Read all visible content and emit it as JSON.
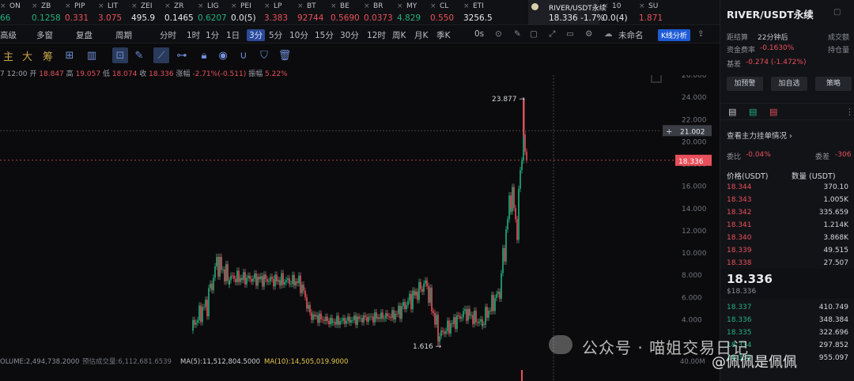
{
  "ticker": [
    {
      "name": "ON",
      "price": "66",
      "color": "#22b07d"
    },
    {
      "name": "ZB",
      "price": "0.1258",
      "color": "#22b07d"
    },
    {
      "name": "PIP",
      "price": "0.331",
      "color": "#e8505b"
    },
    {
      "name": "LIT",
      "price": "3.075",
      "color": "#e8505b"
    },
    {
      "name": "ZEI",
      "price": "495.9",
      "color": "#e7e9ec"
    },
    {
      "name": "ZR",
      "price": "0.1465",
      "color": "#e7e9ec"
    },
    {
      "name": "LIG",
      "price": "0.6207",
      "color": "#22b07d"
    },
    {
      "name": "PEI",
      "price": "0.0(5)",
      "color": "#e7e9ec"
    },
    {
      "name": "LP",
      "price": "3.383",
      "color": "#e8505b"
    },
    {
      "name": "BT",
      "price": "92744",
      "color": "#e8505b"
    },
    {
      "name": "BE",
      "price": "0.5690",
      "color": "#e8505b"
    },
    {
      "name": "BR",
      "price": "0.0373",
      "color": "#e8505b"
    },
    {
      "name": "MY",
      "price": "4.829",
      "color": "#22b07d"
    },
    {
      "name": "CL",
      "price": "0.550",
      "color": "#e8505b"
    },
    {
      "name": "ETI",
      "price": "3256.5",
      "color": "#e7e9ec"
    },
    {
      "name": "RIVER/USDT永续",
      "price": "18.336 -1.7%",
      "color": "#e7e9ec",
      "active": true
    },
    {
      "name": "10",
      "price": "0.0(4)",
      "color": "#e7e9ec"
    },
    {
      "name": "SU",
      "price": "1.871",
      "color": "#e8505b"
    }
  ],
  "toolbar1": [
    "高级",
    "多窗",
    "复盘",
    "周期",
    "分时",
    "1时",
    "1分",
    "1日",
    "3分",
    "5分",
    "10分",
    "15分",
    "30分",
    "12时",
    "周K",
    "月K",
    "季K",
    "0s",
    "未命名",
    "K线分析"
  ],
  "toolbar2": [
    "主",
    "大",
    "筹"
  ],
  "ohlc": {
    "time": "7 12:00",
    "open_label": "开",
    "open": "18.847",
    "high_label": "高",
    "high": "19.057",
    "low_label": "低",
    "low": "18.074",
    "close_label": "收",
    "close": "18.336",
    "chg_label": "涨幅",
    "chg": "-2.71%(-0.511)",
    "amp_label": "振幅",
    "amp": "5.22%"
  },
  "chart_data": {
    "type": "candlestick",
    "ylim": [
      0.4,
      26.0
    ],
    "y_ticks": [
      "26.000",
      "24.000",
      "22.000",
      "20.000",
      "18.000",
      "16.000",
      "14.000",
      "12.000",
      "10.000",
      "8.000",
      "6.000",
      "4.000"
    ],
    "high_label": "23.877",
    "low_label": "1.616",
    "crosshair_price": "21.002",
    "last_price": "18.336",
    "volume_labels": {
      "vol": "OLUME:2,494,738.2000",
      "est": "预估成交量:6,112,681.6539",
      "ma5": "MA(5):11,512,804.5000",
      "ma10": "MA(10):14,505,019.9000",
      "vol_axis": "40.00M"
    }
  },
  "panel": {
    "title": "RIVER/USDT永续",
    "countdown_label": "距结算",
    "countdown": "22分钟后",
    "volume_label": "成交额",
    "funding_label": "资金费率",
    "funding": "-0.1630%",
    "oi_label": "持仓量",
    "basis_label": "基差",
    "basis": "-0.274 (-1.472%)",
    "buttons": [
      "加预警",
      "加自选",
      "策略"
    ],
    "orderbook_title": "查看主力挂单情况",
    "ratio_left_label": "委比",
    "ratio_left": "-0.04%",
    "ratio_right_label": "委差",
    "ratio_right": "-306",
    "col_price": "价格(USDT)",
    "col_qty": "数量 (USDT)",
    "asks": [
      {
        "p": "18.344",
        "q": "370.10"
      },
      {
        "p": "18.343",
        "q": "1.005K"
      },
      {
        "p": "18.342",
        "q": "335.659"
      },
      {
        "p": "18.341",
        "q": "1.214K"
      },
      {
        "p": "18.340",
        "q": "3.868K"
      },
      {
        "p": "18.339",
        "q": "49.515"
      },
      {
        "p": "18.338",
        "q": "27.507"
      }
    ],
    "last": "18.336",
    "last_sub": "$18.336",
    "bids": [
      {
        "p": "18.337",
        "q": "410.749"
      },
      {
        "p": "18.336",
        "q": "348.384"
      },
      {
        "p": "18.335",
        "q": "322.696"
      },
      {
        "p": "18.334",
        "q": "297.852"
      },
      {
        "p": "18.332",
        "q": "955.097"
      }
    ]
  },
  "watermark": {
    "text": "公众号 · 喵姐交易日记",
    "text2": "@佩佩是佩佩"
  }
}
